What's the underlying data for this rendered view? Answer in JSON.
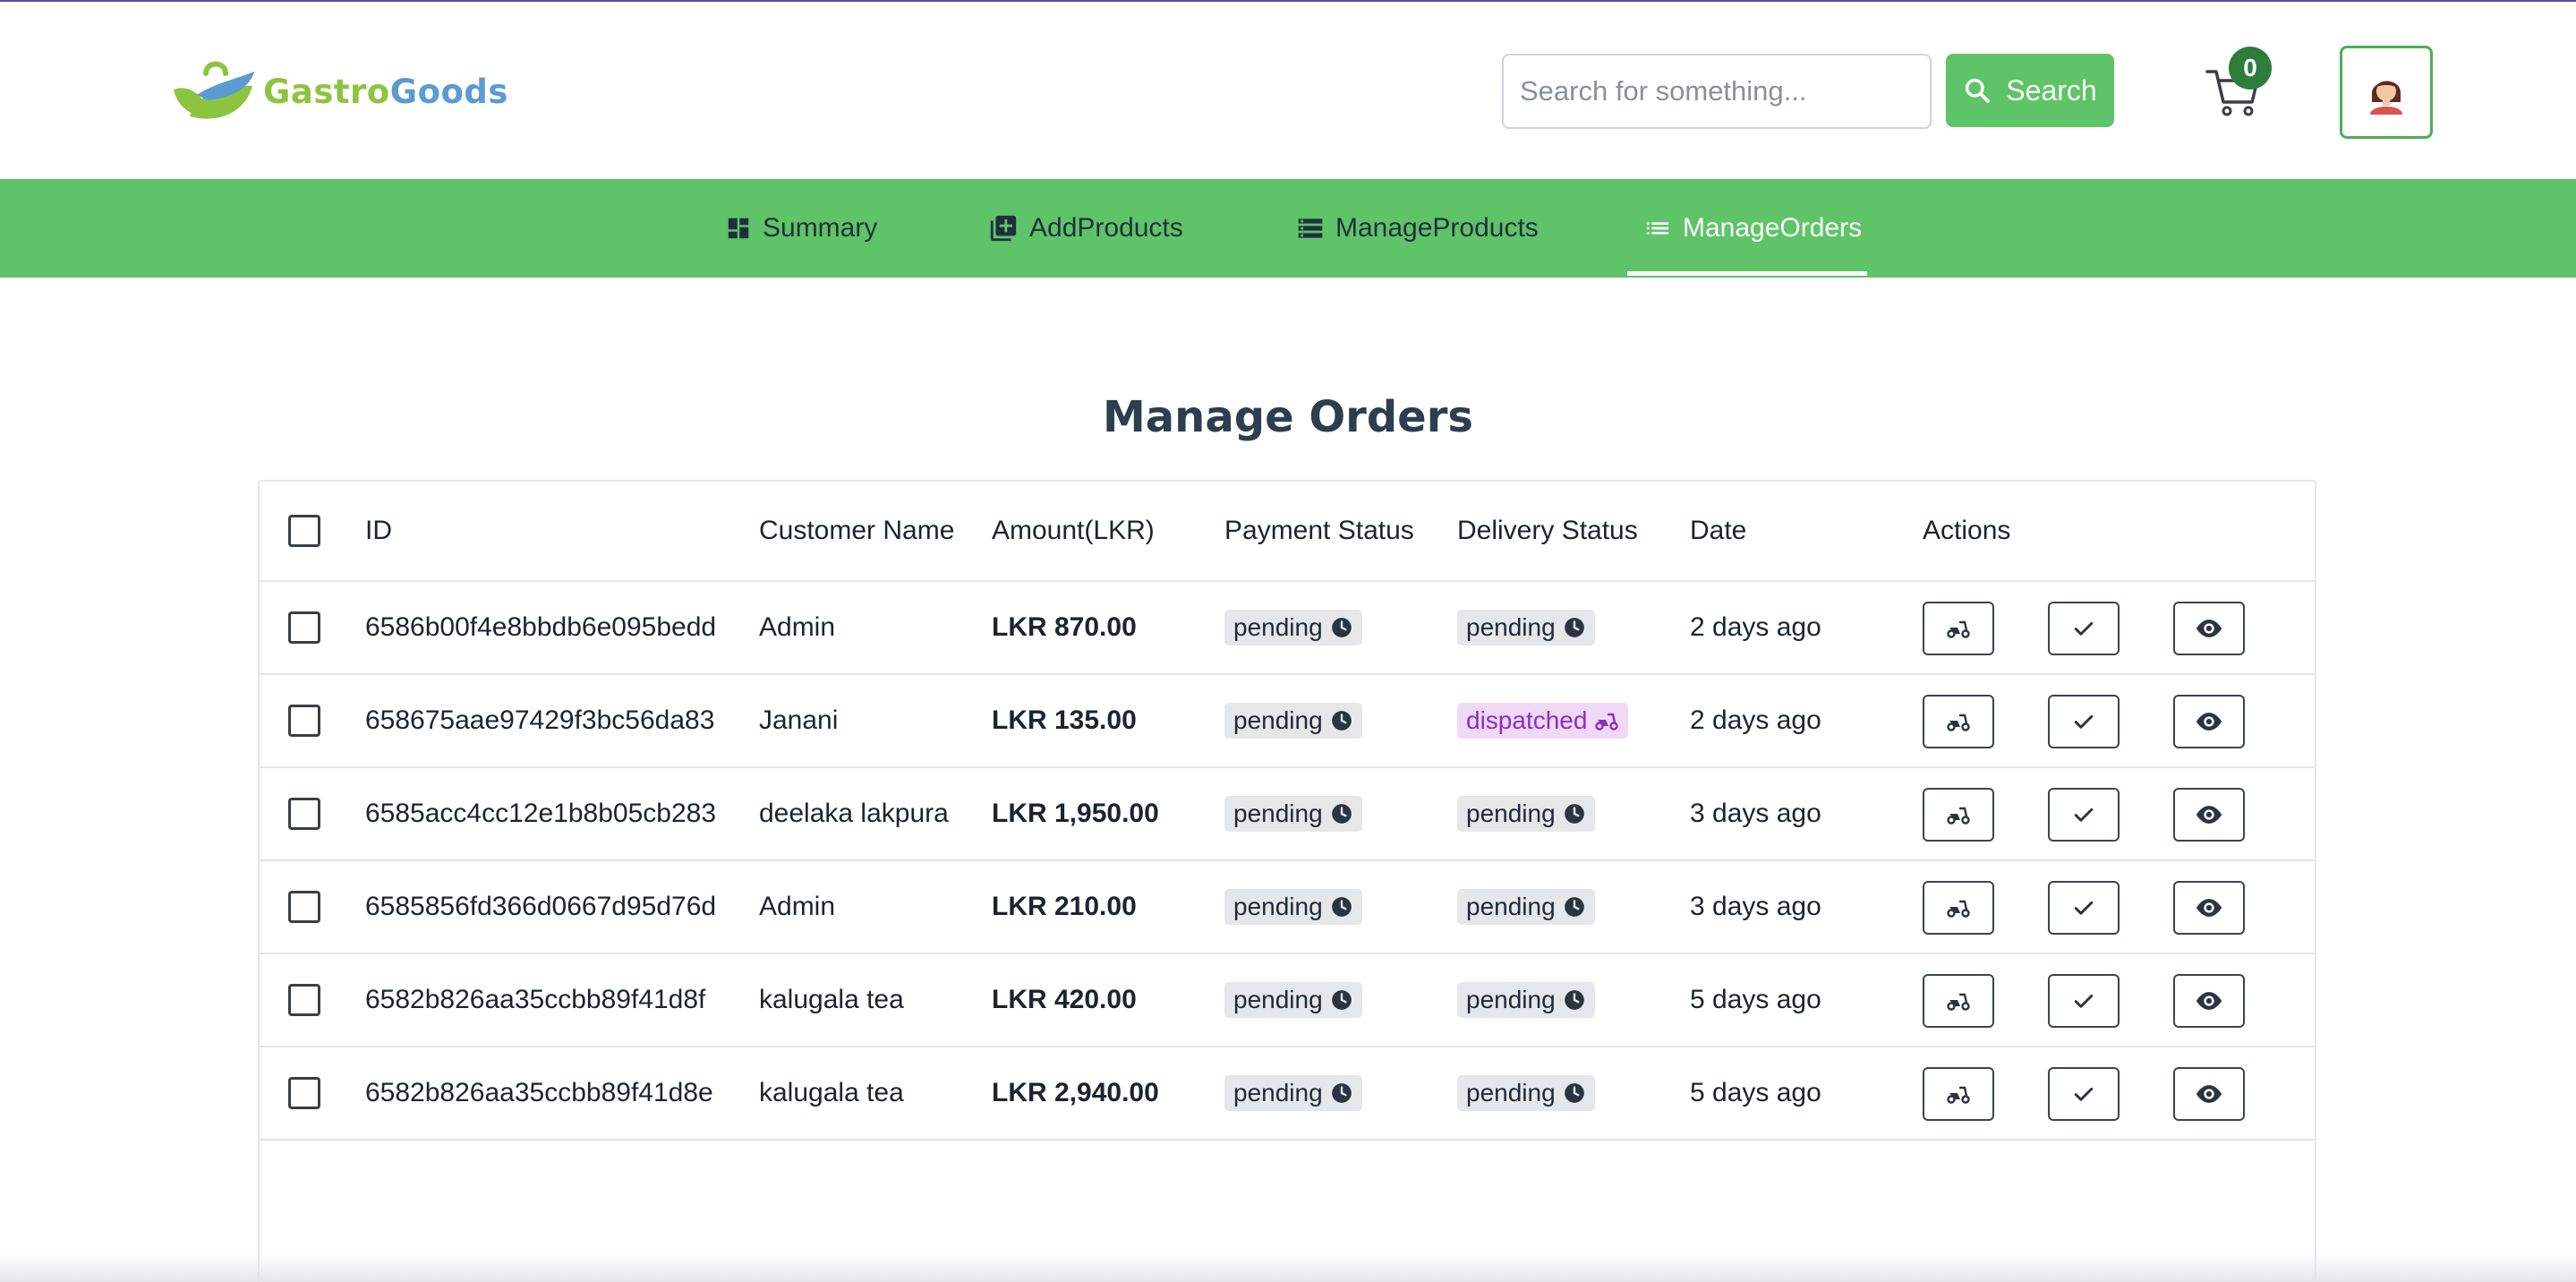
{
  "brand": {
    "name_part1": "Gastro",
    "name_part2": "Goods"
  },
  "search": {
    "placeholder": "Search for something...",
    "button_label": "Search"
  },
  "cart": {
    "count": "0"
  },
  "nav": {
    "items": [
      {
        "label": "Summary",
        "icon": "dashboard-icon"
      },
      {
        "label": "AddProducts",
        "icon": "add-box-icon"
      },
      {
        "label": "ManageProducts",
        "icon": "storage-icon"
      },
      {
        "label": "ManageOrders",
        "icon": "list-icon",
        "active": true
      }
    ]
  },
  "page": {
    "title": "Manage Orders"
  },
  "table": {
    "columns": [
      "ID",
      "Customer Name",
      "Amount(LKR)",
      "Payment Status",
      "Delivery Status",
      "Date",
      "Actions"
    ],
    "rows": [
      {
        "id": "6586b00f4e8bbdb6e095bedd",
        "customer": "Admin",
        "amount": "LKR 870.00",
        "payment": "pending",
        "delivery": "pending",
        "date": "2 days ago"
      },
      {
        "id": "658675aae97429f3bc56da83",
        "customer": "Janani",
        "amount": "LKR 135.00",
        "payment": "pending",
        "delivery": "dispatched",
        "date": "2 days ago"
      },
      {
        "id": "6585acc4cc12e1b8b05cb283",
        "customer": "deelaka lakpura",
        "amount": "LKR 1,950.00",
        "payment": "pending",
        "delivery": "pending",
        "date": "3 days ago"
      },
      {
        "id": "6585856fd366d0667d95d76d",
        "customer": "Admin",
        "amount": "LKR 210.00",
        "payment": "pending",
        "delivery": "pending",
        "date": "3 days ago"
      },
      {
        "id": "6582b826aa35ccbb89f41d8f",
        "customer": "kalugala tea",
        "amount": "LKR 420.00",
        "payment": "pending",
        "delivery": "pending",
        "date": "5 days ago"
      },
      {
        "id": "6582b826aa35ccbb89f41d8e",
        "customer": "kalugala tea",
        "amount": "LKR 2,940.00",
        "payment": "pending",
        "delivery": "pending",
        "date": "5 days ago"
      }
    ]
  },
  "colors": {
    "brand_green": "#5ec467",
    "badge_green": "#2e7d3c",
    "dispatched_purple": "#8a2fc2",
    "title": "#2c3e50"
  }
}
